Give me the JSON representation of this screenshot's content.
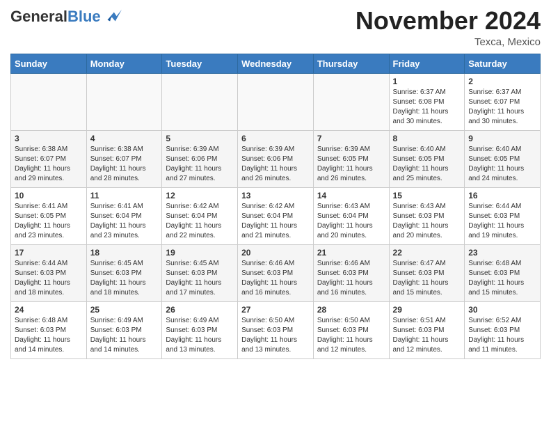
{
  "header": {
    "logo_general": "General",
    "logo_blue": "Blue",
    "month_title": "November 2024",
    "location": "Texca, Mexico"
  },
  "weekdays": [
    "Sunday",
    "Monday",
    "Tuesday",
    "Wednesday",
    "Thursday",
    "Friday",
    "Saturday"
  ],
  "weeks": [
    [
      {
        "day": "",
        "info": ""
      },
      {
        "day": "",
        "info": ""
      },
      {
        "day": "",
        "info": ""
      },
      {
        "day": "",
        "info": ""
      },
      {
        "day": "",
        "info": ""
      },
      {
        "day": "1",
        "info": "Sunrise: 6:37 AM\nSunset: 6:08 PM\nDaylight: 11 hours and 30 minutes."
      },
      {
        "day": "2",
        "info": "Sunrise: 6:37 AM\nSunset: 6:07 PM\nDaylight: 11 hours and 30 minutes."
      }
    ],
    [
      {
        "day": "3",
        "info": "Sunrise: 6:38 AM\nSunset: 6:07 PM\nDaylight: 11 hours and 29 minutes."
      },
      {
        "day": "4",
        "info": "Sunrise: 6:38 AM\nSunset: 6:07 PM\nDaylight: 11 hours and 28 minutes."
      },
      {
        "day": "5",
        "info": "Sunrise: 6:39 AM\nSunset: 6:06 PM\nDaylight: 11 hours and 27 minutes."
      },
      {
        "day": "6",
        "info": "Sunrise: 6:39 AM\nSunset: 6:06 PM\nDaylight: 11 hours and 26 minutes."
      },
      {
        "day": "7",
        "info": "Sunrise: 6:39 AM\nSunset: 6:05 PM\nDaylight: 11 hours and 26 minutes."
      },
      {
        "day": "8",
        "info": "Sunrise: 6:40 AM\nSunset: 6:05 PM\nDaylight: 11 hours and 25 minutes."
      },
      {
        "day": "9",
        "info": "Sunrise: 6:40 AM\nSunset: 6:05 PM\nDaylight: 11 hours and 24 minutes."
      }
    ],
    [
      {
        "day": "10",
        "info": "Sunrise: 6:41 AM\nSunset: 6:05 PM\nDaylight: 11 hours and 23 minutes."
      },
      {
        "day": "11",
        "info": "Sunrise: 6:41 AM\nSunset: 6:04 PM\nDaylight: 11 hours and 23 minutes."
      },
      {
        "day": "12",
        "info": "Sunrise: 6:42 AM\nSunset: 6:04 PM\nDaylight: 11 hours and 22 minutes."
      },
      {
        "day": "13",
        "info": "Sunrise: 6:42 AM\nSunset: 6:04 PM\nDaylight: 11 hours and 21 minutes."
      },
      {
        "day": "14",
        "info": "Sunrise: 6:43 AM\nSunset: 6:04 PM\nDaylight: 11 hours and 20 minutes."
      },
      {
        "day": "15",
        "info": "Sunrise: 6:43 AM\nSunset: 6:03 PM\nDaylight: 11 hours and 20 minutes."
      },
      {
        "day": "16",
        "info": "Sunrise: 6:44 AM\nSunset: 6:03 PM\nDaylight: 11 hours and 19 minutes."
      }
    ],
    [
      {
        "day": "17",
        "info": "Sunrise: 6:44 AM\nSunset: 6:03 PM\nDaylight: 11 hours and 18 minutes."
      },
      {
        "day": "18",
        "info": "Sunrise: 6:45 AM\nSunset: 6:03 PM\nDaylight: 11 hours and 18 minutes."
      },
      {
        "day": "19",
        "info": "Sunrise: 6:45 AM\nSunset: 6:03 PM\nDaylight: 11 hours and 17 minutes."
      },
      {
        "day": "20",
        "info": "Sunrise: 6:46 AM\nSunset: 6:03 PM\nDaylight: 11 hours and 16 minutes."
      },
      {
        "day": "21",
        "info": "Sunrise: 6:46 AM\nSunset: 6:03 PM\nDaylight: 11 hours and 16 minutes."
      },
      {
        "day": "22",
        "info": "Sunrise: 6:47 AM\nSunset: 6:03 PM\nDaylight: 11 hours and 15 minutes."
      },
      {
        "day": "23",
        "info": "Sunrise: 6:48 AM\nSunset: 6:03 PM\nDaylight: 11 hours and 15 minutes."
      }
    ],
    [
      {
        "day": "24",
        "info": "Sunrise: 6:48 AM\nSunset: 6:03 PM\nDaylight: 11 hours and 14 minutes."
      },
      {
        "day": "25",
        "info": "Sunrise: 6:49 AM\nSunset: 6:03 PM\nDaylight: 11 hours and 14 minutes."
      },
      {
        "day": "26",
        "info": "Sunrise: 6:49 AM\nSunset: 6:03 PM\nDaylight: 11 hours and 13 minutes."
      },
      {
        "day": "27",
        "info": "Sunrise: 6:50 AM\nSunset: 6:03 PM\nDaylight: 11 hours and 13 minutes."
      },
      {
        "day": "28",
        "info": "Sunrise: 6:50 AM\nSunset: 6:03 PM\nDaylight: 11 hours and 12 minutes."
      },
      {
        "day": "29",
        "info": "Sunrise: 6:51 AM\nSunset: 6:03 PM\nDaylight: 11 hours and 12 minutes."
      },
      {
        "day": "30",
        "info": "Sunrise: 6:52 AM\nSunset: 6:03 PM\nDaylight: 11 hours and 11 minutes."
      }
    ]
  ]
}
